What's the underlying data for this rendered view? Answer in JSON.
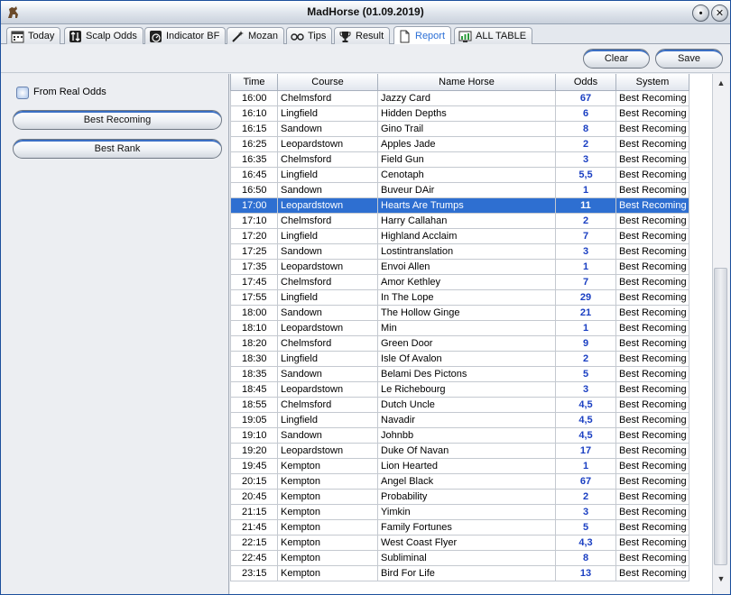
{
  "window": {
    "title": "MadHorse (01.09.2019)",
    "minimize_glyph": "•",
    "close_glyph": "✕"
  },
  "tabs": [
    {
      "label": "Today",
      "icon": "calendar-icon",
      "active": false
    },
    {
      "label": "Scalp Odds",
      "icon": "arrows-icon",
      "active": false
    },
    {
      "label": "Indicator BF",
      "icon": "indicator-icon",
      "active": false
    },
    {
      "label": "Mozan",
      "icon": "wand-icon",
      "active": false
    },
    {
      "label": "Tips",
      "icon": "tips-icon",
      "active": false
    },
    {
      "label": "Result",
      "icon": "trophy-icon",
      "active": false
    },
    {
      "label": "Report",
      "icon": "document-icon",
      "active": true
    },
    {
      "label": "ALL TABLE",
      "icon": "chart-icon",
      "active": false
    }
  ],
  "toolbar": {
    "clear_label": "Clear",
    "save_label": "Save"
  },
  "left_panel": {
    "checkbox_label": "From Real Odds",
    "best_recoming_label": "Best Recoming",
    "best_rank_label": "Best Rank"
  },
  "grid": {
    "headers": [
      "Time",
      "Course",
      "Name Horse",
      "Odds",
      "System"
    ],
    "selected_index": 7,
    "rows": [
      [
        "16:00",
        "Chelmsford",
        "Jazzy Card",
        "67",
        "Best Recoming"
      ],
      [
        "16:10",
        "Lingfield",
        "Hidden Depths",
        "6",
        "Best Recoming"
      ],
      [
        "16:15",
        "Sandown",
        "Gino Trail",
        "8",
        "Best Recoming"
      ],
      [
        "16:25",
        "Leopardstown",
        "Apples Jade",
        "2",
        "Best Recoming"
      ],
      [
        "16:35",
        "Chelmsford",
        "Field Gun",
        "3",
        "Best Recoming"
      ],
      [
        "16:45",
        "Lingfield",
        "Cenotaph",
        "5,5",
        "Best Recoming"
      ],
      [
        "16:50",
        "Sandown",
        "Buveur DAir",
        "1",
        "Best Recoming"
      ],
      [
        "17:00",
        "Leopardstown",
        "Hearts Are Trumps",
        "11",
        "Best Recoming"
      ],
      [
        "17:10",
        "Chelmsford",
        "Harry Callahan",
        "2",
        "Best Recoming"
      ],
      [
        "17:20",
        "Lingfield",
        "Highland Acclaim",
        "7",
        "Best Recoming"
      ],
      [
        "17:25",
        "Sandown",
        "Lostintranslation",
        "3",
        "Best Recoming"
      ],
      [
        "17:35",
        "Leopardstown",
        "Envoi Allen",
        "1",
        "Best Recoming"
      ],
      [
        "17:45",
        "Chelmsford",
        "Amor Kethley",
        "7",
        "Best Recoming"
      ],
      [
        "17:55",
        "Lingfield",
        "In The Lope",
        "29",
        "Best Recoming"
      ],
      [
        "18:00",
        "Sandown",
        "The Hollow Ginge",
        "21",
        "Best Recoming"
      ],
      [
        "18:10",
        "Leopardstown",
        "Min",
        "1",
        "Best Recoming"
      ],
      [
        "18:20",
        "Chelmsford",
        "Green Door",
        "9",
        "Best Recoming"
      ],
      [
        "18:30",
        "Lingfield",
        "Isle Of Avalon",
        "2",
        "Best Recoming"
      ],
      [
        "18:35",
        "Sandown",
        "Belami Des Pictons",
        "5",
        "Best Recoming"
      ],
      [
        "18:45",
        "Leopardstown",
        "Le Richebourg",
        "3",
        "Best Recoming"
      ],
      [
        "18:55",
        "Chelmsford",
        "Dutch Uncle",
        "4,5",
        "Best Recoming"
      ],
      [
        "19:05",
        "Lingfield",
        "Navadir",
        "4,5",
        "Best Recoming"
      ],
      [
        "19:10",
        "Sandown",
        "Johnbb",
        "4,5",
        "Best Recoming"
      ],
      [
        "19:20",
        "Leopardstown",
        "Duke Of Navan",
        "17",
        "Best Recoming"
      ],
      [
        "19:45",
        "Kempton",
        "Lion Hearted",
        "1",
        "Best Recoming"
      ],
      [
        "20:15",
        "Kempton",
        "Angel Black",
        "67",
        "Best Recoming"
      ],
      [
        "20:45",
        "Kempton",
        "Probability",
        "2",
        "Best Recoming"
      ],
      [
        "21:15",
        "Kempton",
        "Yimkin",
        "3",
        "Best Recoming"
      ],
      [
        "21:45",
        "Kempton",
        "Family Fortunes",
        "5",
        "Best Recoming"
      ],
      [
        "22:15",
        "Kempton",
        "West Coast Flyer",
        "4,3",
        "Best Recoming"
      ],
      [
        "22:45",
        "Kempton",
        "Subliminal",
        "8",
        "Best Recoming"
      ],
      [
        "23:15",
        "Kempton",
        "Bird For Life",
        "13",
        "Best Recoming"
      ]
    ]
  },
  "scrollbar": {
    "up_glyph": "▲",
    "down_glyph": "▼"
  },
  "colors": {
    "selection": "#2e6fd1",
    "odds_text": "#1a3fc2",
    "button_accent": "#3a6fc4"
  }
}
